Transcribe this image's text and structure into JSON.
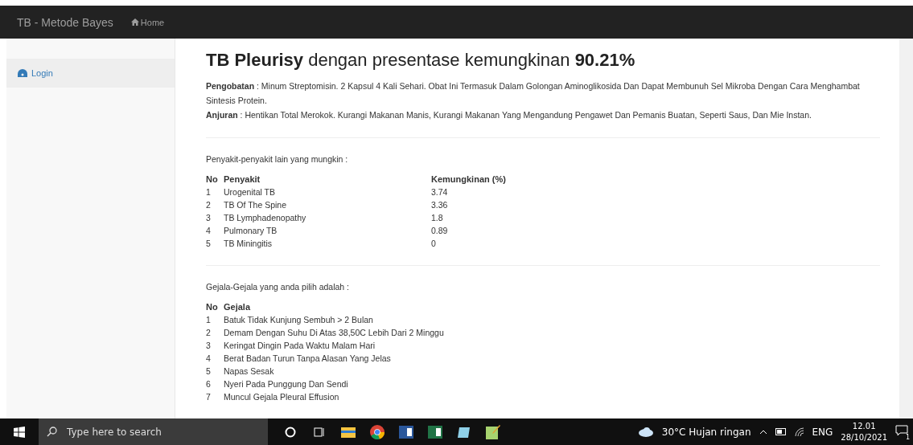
{
  "navbar": {
    "brand": "TB - Metode Bayes",
    "links": [
      {
        "label": "Home"
      }
    ]
  },
  "sidebar": {
    "items": [
      {
        "label": "Login"
      }
    ]
  },
  "result": {
    "heading": "**TB Pleurisy** dengan presentase kemungkinan **90.21%**",
    "paragraphs": [
      "**Pengobatan** : Minum Streptomisin. 2 Kapsul 4 Kali Sehari. Obat Ini Termasuk Dalam Golongan Aminoglikosida Dan Dapat Membunuh Sel Mikroba Dengan Cara Menghambat Sintesis Protein.",
      "**Anjuran** : Hentikan Total Merokok. Kurangi Makanan Manis, Kurangi Makanan Yang Mengandung Pengawet Dan Pemanis Buatan, Seperti Saus, Dan Mie Instan."
    ]
  },
  "other_diseases": {
    "intro": "Penyakit-penyakit lain yang mungkin :",
    "columns": [
      "No",
      "Penyakit",
      "Kemungkinan (%)"
    ],
    "rows": [
      [
        "1",
        "Urogenital TB",
        "3.74"
      ],
      [
        "2",
        "TB Of The Spine",
        "3.36"
      ],
      [
        "3",
        "TB Lymphadenopathy",
        "1.8"
      ],
      [
        "4",
        "Pulmonary TB",
        "0.89"
      ],
      [
        "5",
        "TB Miningitis",
        "0"
      ]
    ]
  },
  "symptoms": {
    "intro": "Gejala-Gejala yang anda pilih adalah :",
    "columns": [
      "No",
      "Gejala"
    ],
    "rows": [
      [
        "1",
        "Batuk Tidak Kunjung Sembuh > 2 Bulan"
      ],
      [
        "2",
        "Demam Dengan Suhu Di Atas 38,50C Lebih Dari 2 Minggu"
      ],
      [
        "3",
        "Keringat Dingin Pada Waktu Malam Hari"
      ],
      [
        "4",
        "Berat Badan Turun Tanpa Alasan Yang Jelas"
      ],
      [
        "5",
        "Napas Sesak"
      ],
      [
        "6",
        "Nyeri Pada Punggung Dan Sendi"
      ],
      [
        "7",
        "Muncul Gejala Pleural Effusion"
      ]
    ]
  },
  "taskbar": {
    "search_placeholder": "Type here to search",
    "weather": "30°C  Hujan ringan",
    "language": "ENG",
    "time": "12.01",
    "date": "28/10/2021",
    "notifications": "1"
  }
}
